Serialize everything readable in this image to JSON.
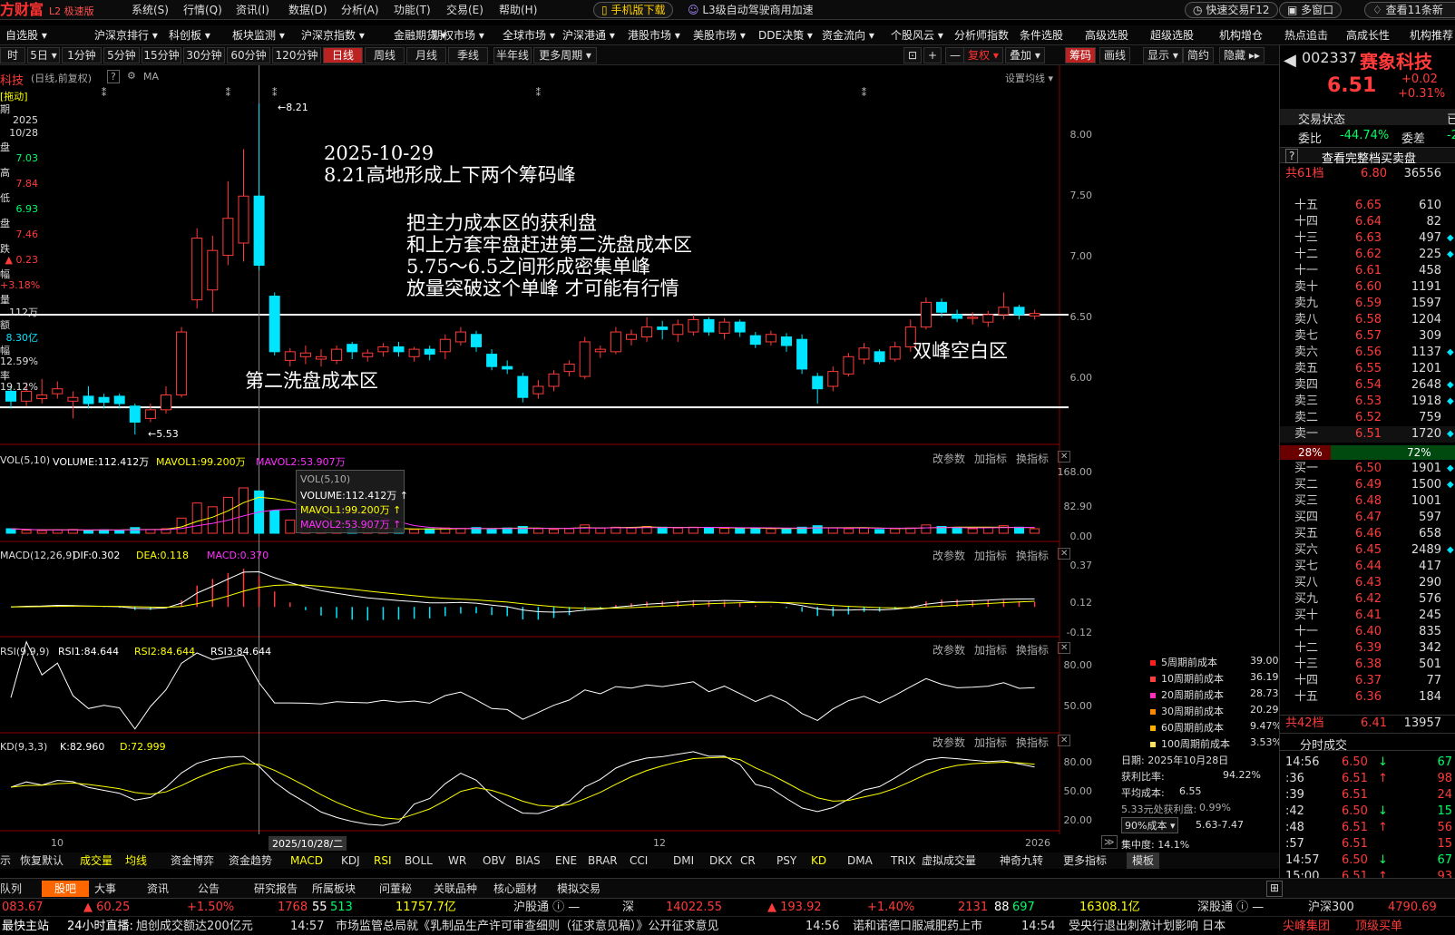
{
  "app": {
    "logo": "方财富",
    "edition": "L2 极速版"
  },
  "menu": [
    "系统(S)",
    "行情(Q)",
    "资讯(I)",
    "数据(D)",
    "分析(A)",
    "功能(T)",
    "交易(E)",
    "帮助(H)"
  ],
  "top_buttons": {
    "mobile": "手机版下载",
    "l3": "L3级自动驾驶商用加速",
    "quick_trade": "快速交易F12",
    "multi_window": "多窗口",
    "news": "查看11条新"
  },
  "nav": [
    "自选股 ▾",
    "沪深京排行 ▾",
    "科创板 ▾",
    "板块监测 ▾",
    "沪深京指数 ▾",
    "金融期货 ▾",
    "期权市场 ▾",
    "全球市场 ▾",
    "沪深港通 ▾",
    "港股市场 ▾",
    "美股市场 ▾",
    "DDE决策 ▾",
    "资金流向 ▾",
    "个股风云 ▾",
    "分析师指数",
    "条件选股",
    "高级选股",
    "超级选股",
    "机构增仓",
    "热点追击",
    "高成长性",
    "机构推荐"
  ],
  "periods": [
    "时",
    "5日 ▾",
    "1分钟",
    "5分钟",
    "15分钟",
    "30分钟",
    "60分钟",
    "120分钟",
    "日线",
    "周线",
    "月线",
    "季线",
    "半年线",
    "更多周期 ▾"
  ],
  "period_active": "日线",
  "chart_tools": [
    "⊡",
    "+",
    "—",
    "复权 ▾",
    "叠加 ▾",
    "筹码",
    "画线",
    "显示 ▾",
    "简约",
    "隐藏 ▸▸"
  ],
  "chart_header": {
    "name": "科技",
    "mode": "(日线,前复权)",
    "help": "?",
    "ma": "MA",
    "setting": "设置均线 ▾"
  },
  "left_info": {
    "drag": "[拖动]",
    "rows": [
      {
        "k": "期",
        "v": ""
      },
      {
        "k": "",
        "v": "2025"
      },
      {
        "k": "",
        "v": "10/28"
      },
      {
        "k": "盘",
        "v": ""
      },
      {
        "k": "",
        "v": "7.03"
      },
      {
        "k": "高",
        "v": ""
      },
      {
        "k": "",
        "v": "7.84"
      },
      {
        "k": "低",
        "v": ""
      },
      {
        "k": "",
        "v": "6.93"
      },
      {
        "k": "盘",
        "v": ""
      },
      {
        "k": "",
        "v": "7.46"
      },
      {
        "k": "跌",
        "v": ""
      },
      {
        "k": "",
        "v": "▲ 0.23"
      },
      {
        "k": "幅",
        "v": ""
      },
      {
        "k": "",
        "v": "+3.18%"
      },
      {
        "k": "量",
        "v": ""
      },
      {
        "k": "",
        "v": "112万"
      },
      {
        "k": "额",
        "v": ""
      },
      {
        "k": "",
        "v": "8.30亿"
      },
      {
        "k": "幅",
        "v": ""
      },
      {
        "k": "",
        "v": "12.59%"
      },
      {
        "k": "率",
        "v": ""
      },
      {
        "k": "",
        "v": "19.12%"
      }
    ]
  },
  "annotations": {
    "title1": "2025-10-29",
    "title2": "8.21高地形成上下两个筹码峰",
    "body1": "把主力成本区的获利盘",
    "body2": "和上方套牢盘赶进第二洗盘成本区",
    "body3": "5.75～6.5之间形成密集单峰",
    "body4": "放量突破这个单峰 才可能有行情",
    "wash": "第二洗盘成本区",
    "gap": "双峰空白区",
    "high": "8.21",
    "low": "5.53"
  },
  "price_axis": [
    "8.00",
    "7.50",
    "7.00",
    "6.50",
    "6.00"
  ],
  "x_labels": {
    "oct": "10",
    "dec": "12",
    "year": "2026",
    "cursor_date": "2025/10/28/二"
  },
  "vol_panel": {
    "title": "VOL(5,10)",
    "volume": "VOLUME:112.412万",
    "mavol1": "MAVOL1:99.200万",
    "mavol2": "MAVOL2:53.907万",
    "axis": [
      "168.00",
      "82.90",
      "0.00"
    ]
  },
  "macd_panel": {
    "title": "MACD(12,26,9)",
    "dif": "DIF:0.302",
    "dea": "DEA:0.118",
    "macd": "MACD:0.370",
    "axis": [
      "0.37",
      "0.12",
      "-0.12"
    ]
  },
  "rsi_panel": {
    "title": "RSI(9,9,9)",
    "rsi1": "RSI1:84.644",
    "rsi2": "RSI2:84.644",
    "rsi3": "RSI3:84.644",
    "axis": [
      "80.00",
      "50.00"
    ]
  },
  "kd_panel": {
    "title": "KD(9,3,3)",
    "k": "K:82.960",
    "d": "D:72.999",
    "axis": [
      "80.00",
      "50.00",
      "20.00"
    ]
  },
  "panel_controls": [
    "改参数",
    "加指标",
    "换指标",
    "✕"
  ],
  "tooltip": {
    "title": "VOL(5,10)",
    "volume": "VOLUME:112.412万 ↑",
    "mavol1": "MAVOL1:99.200万 ↑",
    "mavol2": "MAVOL2:53.907万 ↑"
  },
  "cost_legend": [
    {
      "label": "5周期前成本",
      "value": "39.00%",
      "color": "#ff2020"
    },
    {
      "label": "10周期前成本",
      "value": "36.19%",
      "color": "#ff4040"
    },
    {
      "label": "20周期前成本",
      "value": "28.73%",
      "color": "#ff30c0"
    },
    {
      "label": "30周期前成本",
      "value": "20.29%",
      "color": "#ff8a00"
    },
    {
      "label": "60周期前成本",
      "value": "9.47%",
      "color": "#ffb000"
    },
    {
      "label": "100周期前成本",
      "value": "3.53%",
      "color": "#ffe060"
    }
  ],
  "chip_info": {
    "date": "日期: 2025年10月28日",
    "profit_label": "获利比率:",
    "profit_value": "94.22%",
    "avg_label": "平均成本:",
    "avg_value": "6.55",
    "at_label": "5.33元处获利盘:",
    "at_value": "0.99%",
    "select": "90%成本 ▾",
    "range": "5.63-7.47",
    "concentration": "集中度: 14.1%"
  },
  "stock": {
    "code": "002337",
    "name": "赛象科技",
    "price": "6.51",
    "change": "+0.02",
    "change_pct": "+0.31%"
  },
  "trade_status": {
    "label": "交易状态",
    "value": "已",
    "ratio_label": "委比",
    "ratio_value": "-44.74%",
    "diff_label": "委差",
    "diff_value": "-2"
  },
  "order_book": {
    "full": "查看完整档买卖盘",
    "sell_total": {
      "label": "共61档",
      "price": "6.80",
      "vol": "36556"
    },
    "sells": [
      {
        "l": "十五",
        "p": "6.65",
        "v": "610",
        "m": ""
      },
      {
        "l": "十四",
        "p": "6.64",
        "v": "82",
        "m": ""
      },
      {
        "l": "十三",
        "p": "6.63",
        "v": "497",
        "m": "◆"
      },
      {
        "l": "十二",
        "p": "6.62",
        "v": "225",
        "m": "◆"
      },
      {
        "l": "十一",
        "p": "6.61",
        "v": "458",
        "m": ""
      },
      {
        "l": "卖十",
        "p": "6.60",
        "v": "1191",
        "m": ""
      },
      {
        "l": "卖九",
        "p": "6.59",
        "v": "1597",
        "m": ""
      },
      {
        "l": "卖八",
        "p": "6.58",
        "v": "1204",
        "m": ""
      },
      {
        "l": "卖七",
        "p": "6.57",
        "v": "309",
        "m": ""
      },
      {
        "l": "卖六",
        "p": "6.56",
        "v": "1137",
        "m": "◆"
      },
      {
        "l": "卖五",
        "p": "6.55",
        "v": "1201",
        "m": ""
      },
      {
        "l": "卖四",
        "p": "6.54",
        "v": "2648",
        "m": "◆"
      },
      {
        "l": "卖三",
        "p": "6.53",
        "v": "1918",
        "m": "◆"
      },
      {
        "l": "卖二",
        "p": "6.52",
        "v": "759",
        "m": ""
      },
      {
        "l": "卖一",
        "p": "6.51",
        "v": "1720",
        "m": "◆"
      }
    ],
    "ratio_sell": "28%",
    "ratio_buy": "72%",
    "buys": [
      {
        "l": "买一",
        "p": "6.50",
        "v": "1901",
        "m": "◆"
      },
      {
        "l": "买二",
        "p": "6.49",
        "v": "1500",
        "m": "◆"
      },
      {
        "l": "买三",
        "p": "6.48",
        "v": "1001",
        "m": ""
      },
      {
        "l": "买四",
        "p": "6.47",
        "v": "597",
        "m": ""
      },
      {
        "l": "买五",
        "p": "6.46",
        "v": "658",
        "m": ""
      },
      {
        "l": "买六",
        "p": "6.45",
        "v": "2489",
        "m": "◆"
      },
      {
        "l": "买七",
        "p": "6.44",
        "v": "417",
        "m": ""
      },
      {
        "l": "买八",
        "p": "6.43",
        "v": "290",
        "m": ""
      },
      {
        "l": "买九",
        "p": "6.42",
        "v": "576",
        "m": ""
      },
      {
        "l": "买十",
        "p": "6.41",
        "v": "245",
        "m": ""
      },
      {
        "l": "十一",
        "p": "6.40",
        "v": "835",
        "m": ""
      },
      {
        "l": "十二",
        "p": "6.39",
        "v": "342",
        "m": ""
      },
      {
        "l": "十三",
        "p": "6.38",
        "v": "501",
        "m": ""
      },
      {
        "l": "十四",
        "p": "6.37",
        "v": "77",
        "m": ""
      },
      {
        "l": "十五",
        "p": "6.36",
        "v": "184",
        "m": ""
      }
    ],
    "buy_total": {
      "label": "共42档",
      "price": "6.41",
      "vol": "13957"
    }
  },
  "ticks": {
    "title": "分时成交",
    "rows": [
      {
        "t": "14:56",
        "p": "6.50",
        "a": "↓",
        "v": "67"
      },
      {
        "t": ":36",
        "p": "6.51",
        "a": "↑",
        "v": "98"
      },
      {
        "t": ":39",
        "p": "6.51",
        "a": "",
        "v": "24"
      },
      {
        "t": ":42",
        "p": "6.50",
        "a": "↓",
        "v": "15"
      },
      {
        "t": ":48",
        "p": "6.51",
        "a": "↑",
        "v": "56"
      },
      {
        "t": ":57",
        "p": "6.51",
        "a": "",
        "v": "15"
      },
      {
        "t": "14:57",
        "p": "6.50",
        "a": "↓",
        "v": "67"
      },
      {
        "t": "15:00",
        "p": "6.51",
        "a": "↑",
        "v": "93"
      }
    ]
  },
  "indicators": [
    "示",
    "恢复默认",
    "成交量",
    "均线",
    "资金博弈",
    "资金趋势",
    "MACD",
    "KDJ",
    "RSI",
    "BOLL",
    "WR",
    "OBV",
    "BIAS",
    "ENE",
    "BRAR",
    "CCI",
    "DMI",
    "DKX",
    "CR",
    "PSY",
    "KD",
    "DMA",
    "TRIX",
    "虚拟成交量",
    "神奇九转",
    "更多指标",
    "模板"
  ],
  "tabs2": [
    "队列",
    "股吧",
    "大事",
    "资讯",
    "公告",
    "研究报告",
    "所属板块",
    "问董秘",
    "关联品种",
    "核心题材",
    "模拟交易"
  ],
  "status": {
    "sh_index": "083.67",
    "sh_change": "▲ 60.25",
    "sh_pct": "+1.50%",
    "sh_up": "1768",
    "sh_flat": "55",
    "sh_down": "513",
    "sh_amount": "11757.7亿",
    "hk_sh": "沪股通 ⓘ —",
    "sz_label": "深",
    "sz_index": "14022.55",
    "sz_change": "▲ 193.92",
    "sz_pct": "+1.40%",
    "sz_up": "2131",
    "sz_flat": "88",
    "sz_down": "697",
    "sz_amount": "16308.1亿",
    "hk_sz": "深股通 ⓘ —",
    "hs300_label": "沪深300",
    "hs300": "4790.69"
  },
  "news": {
    "items": [
      "最快主站",
      "24小时直播:",
      "旭创成交额达200亿元",
      "14:57",
      "市场监管总局就《乳制品生产许可审查细则（征求意见稿）》公开征求意见",
      "14:56",
      "诺和诺德口服减肥药上市",
      "14:54",
      "受央行退出刺激计划影响 日本",
      "尖峰集团",
      "顶级买单"
    ]
  },
  "colors": {
    "up": "#ff3b3b",
    "down": "#00e5ff",
    "yellow": "#ffff00",
    "magenta": "#ff30ff",
    "white": "#ffffff"
  },
  "chart_data": {
    "type": "candlestick",
    "y_range": [
      5.45,
      8.35
    ],
    "candles": [
      {
        "o": 5.88,
        "c": 5.8,
        "h": 5.92,
        "l": 5.74
      },
      {
        "o": 5.8,
        "c": 5.88,
        "h": 5.95,
        "l": 5.76
      },
      {
        "o": 5.82,
        "c": 5.85,
        "h": 5.98,
        "l": 5.78
      },
      {
        "o": 5.86,
        "c": 5.9,
        "h": 5.96,
        "l": 5.82
      },
      {
        "o": 5.8,
        "c": 5.83,
        "h": 5.88,
        "l": 5.66
      },
      {
        "o": 5.84,
        "c": 5.78,
        "h": 5.92,
        "l": 5.74
      },
      {
        "o": 5.83,
        "c": 5.79,
        "h": 5.86,
        "l": 5.74
      },
      {
        "o": 5.84,
        "c": 5.78,
        "h": 5.86,
        "l": 5.74
      },
      {
        "o": 5.76,
        "c": 5.63,
        "h": 5.78,
        "l": 5.53
      },
      {
        "o": 5.66,
        "c": 5.73,
        "h": 5.78,
        "l": 5.63
      },
      {
        "o": 5.73,
        "c": 5.85,
        "h": 5.92,
        "l": 5.7
      },
      {
        "o": 5.85,
        "c": 6.36,
        "h": 6.4,
        "l": 5.83
      },
      {
        "o": 6.62,
        "c": 7.12,
        "h": 7.2,
        "l": 6.55
      },
      {
        "o": 6.7,
        "c": 7.02,
        "h": 7.14,
        "l": 6.52
      },
      {
        "o": 6.98,
        "c": 7.28,
        "h": 7.58,
        "l": 6.9
      },
      {
        "o": 7.08,
        "c": 7.46,
        "h": 7.84,
        "l": 6.93
      },
      {
        "o": 7.46,
        "c": 6.9,
        "h": 8.21,
        "l": 6.86
      },
      {
        "o": 6.65,
        "c": 6.2,
        "h": 6.68,
        "l": 6.17
      },
      {
        "o": 6.13,
        "c": 6.2,
        "h": 6.23,
        "l": 6.08
      },
      {
        "o": 6.16,
        "c": 6.19,
        "h": 6.25,
        "l": 6.1
      },
      {
        "o": 6.14,
        "c": 6.16,
        "h": 6.22,
        "l": 6.08
      },
      {
        "o": 6.13,
        "c": 6.22,
        "h": 6.25,
        "l": 6.1
      },
      {
        "o": 6.26,
        "c": 6.2,
        "h": 6.28,
        "l": 6.14
      },
      {
        "o": 6.16,
        "c": 6.19,
        "h": 6.22,
        "l": 6.12
      },
      {
        "o": 6.2,
        "c": 6.24,
        "h": 6.27,
        "l": 6.16
      },
      {
        "o": 6.24,
        "c": 6.2,
        "h": 6.28,
        "l": 6.16
      },
      {
        "o": 6.16,
        "c": 6.22,
        "h": 6.24,
        "l": 6.12
      },
      {
        "o": 6.22,
        "c": 6.18,
        "h": 6.25,
        "l": 6.13
      },
      {
        "o": 6.2,
        "c": 6.3,
        "h": 6.34,
        "l": 6.14
      },
      {
        "o": 6.28,
        "c": 6.36,
        "h": 6.4,
        "l": 6.25
      },
      {
        "o": 6.34,
        "c": 6.24,
        "h": 6.37,
        "l": 6.2
      },
      {
        "o": 6.18,
        "c": 6.08,
        "h": 6.22,
        "l": 6.05
      },
      {
        "o": 6.08,
        "c": 6.06,
        "h": 6.13,
        "l": 6.02
      },
      {
        "o": 6.0,
        "c": 5.83,
        "h": 6.03,
        "l": 5.79
      },
      {
        "o": 5.86,
        "c": 5.92,
        "h": 5.97,
        "l": 5.82
      },
      {
        "o": 5.92,
        "c": 6.02,
        "h": 6.05,
        "l": 5.88
      },
      {
        "o": 6.04,
        "c": 6.1,
        "h": 6.13,
        "l": 6.0
      },
      {
        "o": 6.0,
        "c": 6.28,
        "h": 6.32,
        "l": 5.98
      },
      {
        "o": 6.2,
        "c": 6.22,
        "h": 6.25,
        "l": 6.15
      },
      {
        "o": 6.2,
        "c": 6.36,
        "h": 6.4,
        "l": 6.18
      },
      {
        "o": 6.3,
        "c": 6.34,
        "h": 6.38,
        "l": 6.25
      },
      {
        "o": 6.32,
        "c": 6.4,
        "h": 6.48,
        "l": 6.28
      },
      {
        "o": 6.4,
        "c": 6.38,
        "h": 6.45,
        "l": 6.3
      },
      {
        "o": 6.34,
        "c": 6.42,
        "h": 6.46,
        "l": 6.28
      },
      {
        "o": 6.36,
        "c": 6.46,
        "h": 6.5,
        "l": 6.33
      },
      {
        "o": 6.46,
        "c": 6.36,
        "h": 6.48,
        "l": 6.33
      },
      {
        "o": 6.35,
        "c": 6.44,
        "h": 6.47,
        "l": 6.3
      },
      {
        "o": 6.44,
        "c": 6.36,
        "h": 6.46,
        "l": 6.32
      },
      {
        "o": 6.33,
        "c": 6.26,
        "h": 6.36,
        "l": 6.23
      },
      {
        "o": 6.28,
        "c": 6.34,
        "h": 6.37,
        "l": 6.25
      },
      {
        "o": 6.32,
        "c": 6.25,
        "h": 6.35,
        "l": 6.2
      },
      {
        "o": 6.3,
        "c": 6.06,
        "h": 6.34,
        "l": 6.02
      },
      {
        "o": 6.0,
        "c": 5.9,
        "h": 6.03,
        "l": 5.78
      },
      {
        "o": 5.92,
        "c": 6.04,
        "h": 6.08,
        "l": 5.88
      },
      {
        "o": 6.02,
        "c": 6.16,
        "h": 6.19,
        "l": 6.0
      },
      {
        "o": 6.14,
        "c": 6.23,
        "h": 6.27,
        "l": 6.1
      },
      {
        "o": 6.2,
        "c": 6.12,
        "h": 6.22,
        "l": 6.1
      },
      {
        "o": 6.14,
        "c": 6.24,
        "h": 6.28,
        "l": 6.12
      },
      {
        "o": 6.24,
        "c": 6.4,
        "h": 6.46,
        "l": 6.2
      },
      {
        "o": 6.4,
        "c": 6.6,
        "h": 6.64,
        "l": 6.38
      },
      {
        "o": 6.6,
        "c": 6.52,
        "h": 6.63,
        "l": 6.48
      },
      {
        "o": 6.5,
        "c": 6.47,
        "h": 6.54,
        "l": 6.44
      },
      {
        "o": 6.47,
        "c": 6.48,
        "h": 6.52,
        "l": 6.42
      },
      {
        "o": 6.44,
        "c": 6.5,
        "h": 6.53,
        "l": 6.4
      },
      {
        "o": 6.5,
        "c": 6.56,
        "h": 6.68,
        "l": 6.46
      },
      {
        "o": 6.56,
        "c": 6.5,
        "h": 6.58,
        "l": 6.46
      },
      {
        "o": 6.49,
        "c": 6.51,
        "h": 6.54,
        "l": 6.46
      }
    ],
    "horizontal_lines": [
      6.5,
      5.75
    ],
    "volume_range": [
      0,
      168
    ],
    "volume": [
      12,
      8,
      7,
      9,
      10,
      8,
      9,
      7,
      15,
      10,
      12,
      40,
      80,
      70,
      95,
      120,
      112,
      60,
      35,
      20,
      15,
      15,
      12,
      14,
      10,
      12,
      10,
      12,
      14,
      13,
      15,
      10,
      14,
      18,
      12,
      10,
      12,
      22,
      14,
      16,
      14,
      18,
      16,
      14,
      16,
      14,
      13,
      12,
      14,
      12,
      11,
      16,
      20,
      14,
      12,
      14,
      10,
      12,
      14,
      22,
      18,
      14,
      12,
      15,
      20,
      16,
      12
    ],
    "macd_range": [
      -0.2,
      0.45
    ]
  }
}
